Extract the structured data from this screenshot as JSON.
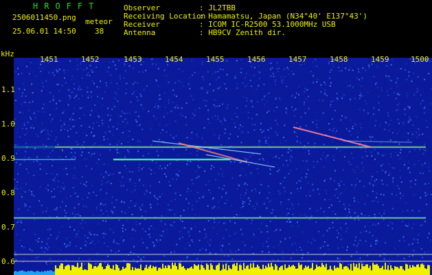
{
  "header": {
    "app_title": "HROFFT",
    "filename": "2506011450.png",
    "mode": "meteor",
    "timestamp": "25.06.01 14:50",
    "count": "38",
    "fields": [
      {
        "label": "Observer",
        "value": ": JL2TBB"
      },
      {
        "label": "Receiving Location",
        "value": ": Hamamatsu, Japan (N34°40' E137°43')"
      },
      {
        "label": "Receiver",
        "value": ": ICOM IC-R2500 53.1000MHz USB"
      },
      {
        "label": "Antenna",
        "value": ": HB9CV Zenith dir."
      }
    ]
  },
  "axis": {
    "y_unit": "kHz",
    "x_ticks": [
      "1451",
      "1452",
      "1453",
      "1454",
      "1455",
      "1456",
      "1457",
      "1458",
      "1459",
      "1500"
    ],
    "y_ticks": [
      "1.1",
      "1.0",
      "0.9",
      "0.8",
      "0.7",
      "0.6"
    ]
  },
  "colors": {
    "background": "#000000",
    "noise": "#0a1aa0",
    "label_green": "#21e021",
    "label_yellow": "#f0f000"
  }
}
